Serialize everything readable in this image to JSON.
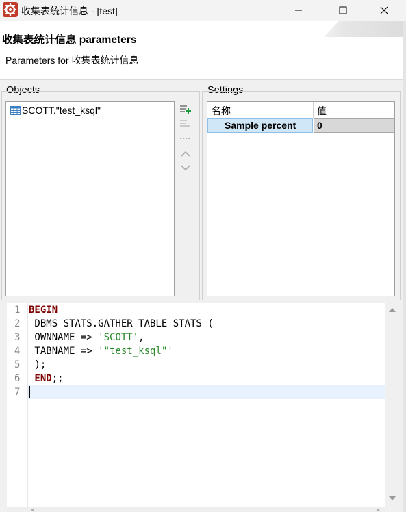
{
  "window": {
    "title": "收集表统计信息 - [test]",
    "controls": [
      "minimize",
      "maximize",
      "close"
    ]
  },
  "header": {
    "title": "收集表统计信息 parameters",
    "description": "Parameters for 收集表统计信息"
  },
  "objects": {
    "label": "Objects",
    "items": [
      {
        "name": "SCOTT.\"test_ksql\"",
        "icon": "table-icon"
      }
    ],
    "toolbar": [
      "add-icon",
      "remove-icon",
      "configure-icon",
      "move-up-icon",
      "move-down-icon"
    ]
  },
  "settings": {
    "label": "Settings",
    "columns": [
      "名称",
      "值"
    ],
    "rows": [
      {
        "name": "Sample percent",
        "value": "0"
      }
    ]
  },
  "editor": {
    "line_numbers": [
      "1",
      "2",
      "3",
      "4",
      "5",
      "6",
      "7"
    ],
    "lines": [
      [
        {
          "t": "BEGIN",
          "c": "kw"
        }
      ],
      [
        {
          "t": " DBMS_STATS.GATHER_TABLE_STATS (",
          "c": "plain"
        }
      ],
      [
        {
          "t": " OWNNAME => ",
          "c": "plain"
        },
        {
          "t": "'SCOTT'",
          "c": "str"
        },
        {
          "t": ",",
          "c": "plain"
        }
      ],
      [
        {
          "t": " TABNAME => ",
          "c": "plain"
        },
        {
          "t": "'\"test_ksql\"'",
          "c": "str"
        }
      ],
      [
        {
          "t": " );",
          "c": "plain"
        }
      ],
      [
        {
          "t": " END",
          "c": "kw"
        },
        {
          "t": ";;",
          "c": "plain"
        }
      ],
      [
        {
          "t": "",
          "c": "plain"
        }
      ]
    ]
  },
  "colors": {
    "keyword": "#7f0000",
    "string": "#2a8a2a",
    "selected_row": "#cfe7f7",
    "current_line": "#e8f2fe"
  }
}
